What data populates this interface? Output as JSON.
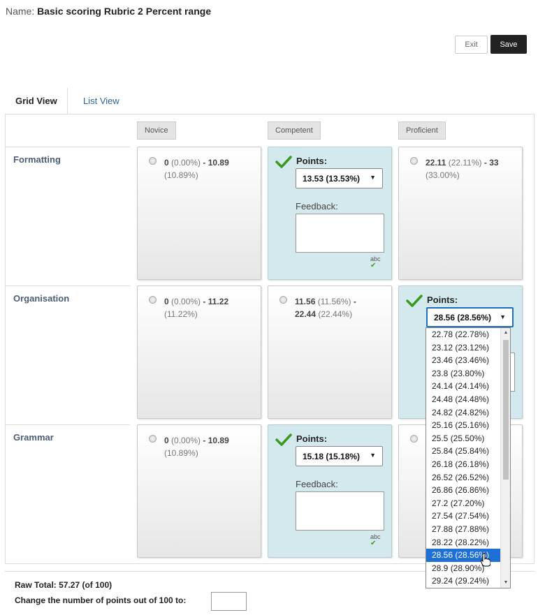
{
  "header": {
    "name_label": "Name:",
    "name_value": "Basic scoring Rubric 2 Percent range",
    "exit_label": "Exit",
    "save_label": "Save"
  },
  "tabs": [
    {
      "label": "Grid View",
      "active": true
    },
    {
      "label": "List View",
      "active": false
    }
  ],
  "levels": [
    "Novice",
    "Competent",
    "Proficient"
  ],
  "criteria": [
    {
      "name": "Formatting",
      "cells": [
        {
          "low": "0",
          "low_pct": "(0.00%)",
          "sep": "-",
          "high": "10.89",
          "high_pct": "(10.89%)"
        },
        {
          "selected": true,
          "points_label": "Points:",
          "value": "13.53 (13.53%)",
          "feedback_label": "Feedback:",
          "spell": "abc"
        },
        {
          "low": "22.11",
          "low_pct": "(22.11%)",
          "sep": "-",
          "high": "33",
          "high_pct": "(33.00%)"
        }
      ]
    },
    {
      "name": "Organisation",
      "cells": [
        {
          "low": "0",
          "low_pct": "(0.00%)",
          "sep": "-",
          "high": "11.22",
          "high_pct": "(11.22%)"
        },
        {
          "low": "11.56",
          "low_pct": "(11.56%)",
          "sep": "-",
          "high": "22.44",
          "high_pct": "(22.44%)"
        },
        {
          "selected": true,
          "points_label": "Points:",
          "value": "28.56 (28.56%)"
        }
      ]
    },
    {
      "name": "Grammar",
      "cells": [
        {
          "low": "0",
          "low_pct": "(0.00%)",
          "sep": "-",
          "high": "10.89",
          "high_pct": "(10.89%)"
        },
        {
          "selected": true,
          "points_label": "Points:",
          "value": "15.18 (15.18%)",
          "feedback_label": "Feedback:",
          "spell": "abc"
        },
        {}
      ]
    }
  ],
  "dropdown": {
    "options": [
      "22.78 (22.78%)",
      "23.12 (23.12%)",
      "23.46 (23.46%)",
      "23.8 (23.80%)",
      "24.14 (24.14%)",
      "24.48 (24.48%)",
      "24.82 (24.82%)",
      "25.16 (25.16%)",
      "25.5 (25.50%)",
      "25.84 (25.84%)",
      "26.18 (26.18%)",
      "26.52 (26.52%)",
      "26.86 (26.86%)",
      "27.2 (27.20%)",
      "27.54 (27.54%)",
      "27.88 (27.88%)",
      "28.22 (28.22%)",
      "28.56 (28.56%)",
      "28.9 (28.90%)",
      "29.24 (29.24%)"
    ],
    "highlighted": "28.56 (28.56%)"
  },
  "totals": {
    "raw_total": "Raw Total: 57.27 (of 100)",
    "change_label": "Change the number of points out of 100 to:",
    "change_value": ""
  },
  "colors": {
    "selected_cell": "#d4e9ee",
    "highlight": "#1e70d6",
    "save_button": "#222222",
    "criterion_name": "#4b5e74"
  }
}
